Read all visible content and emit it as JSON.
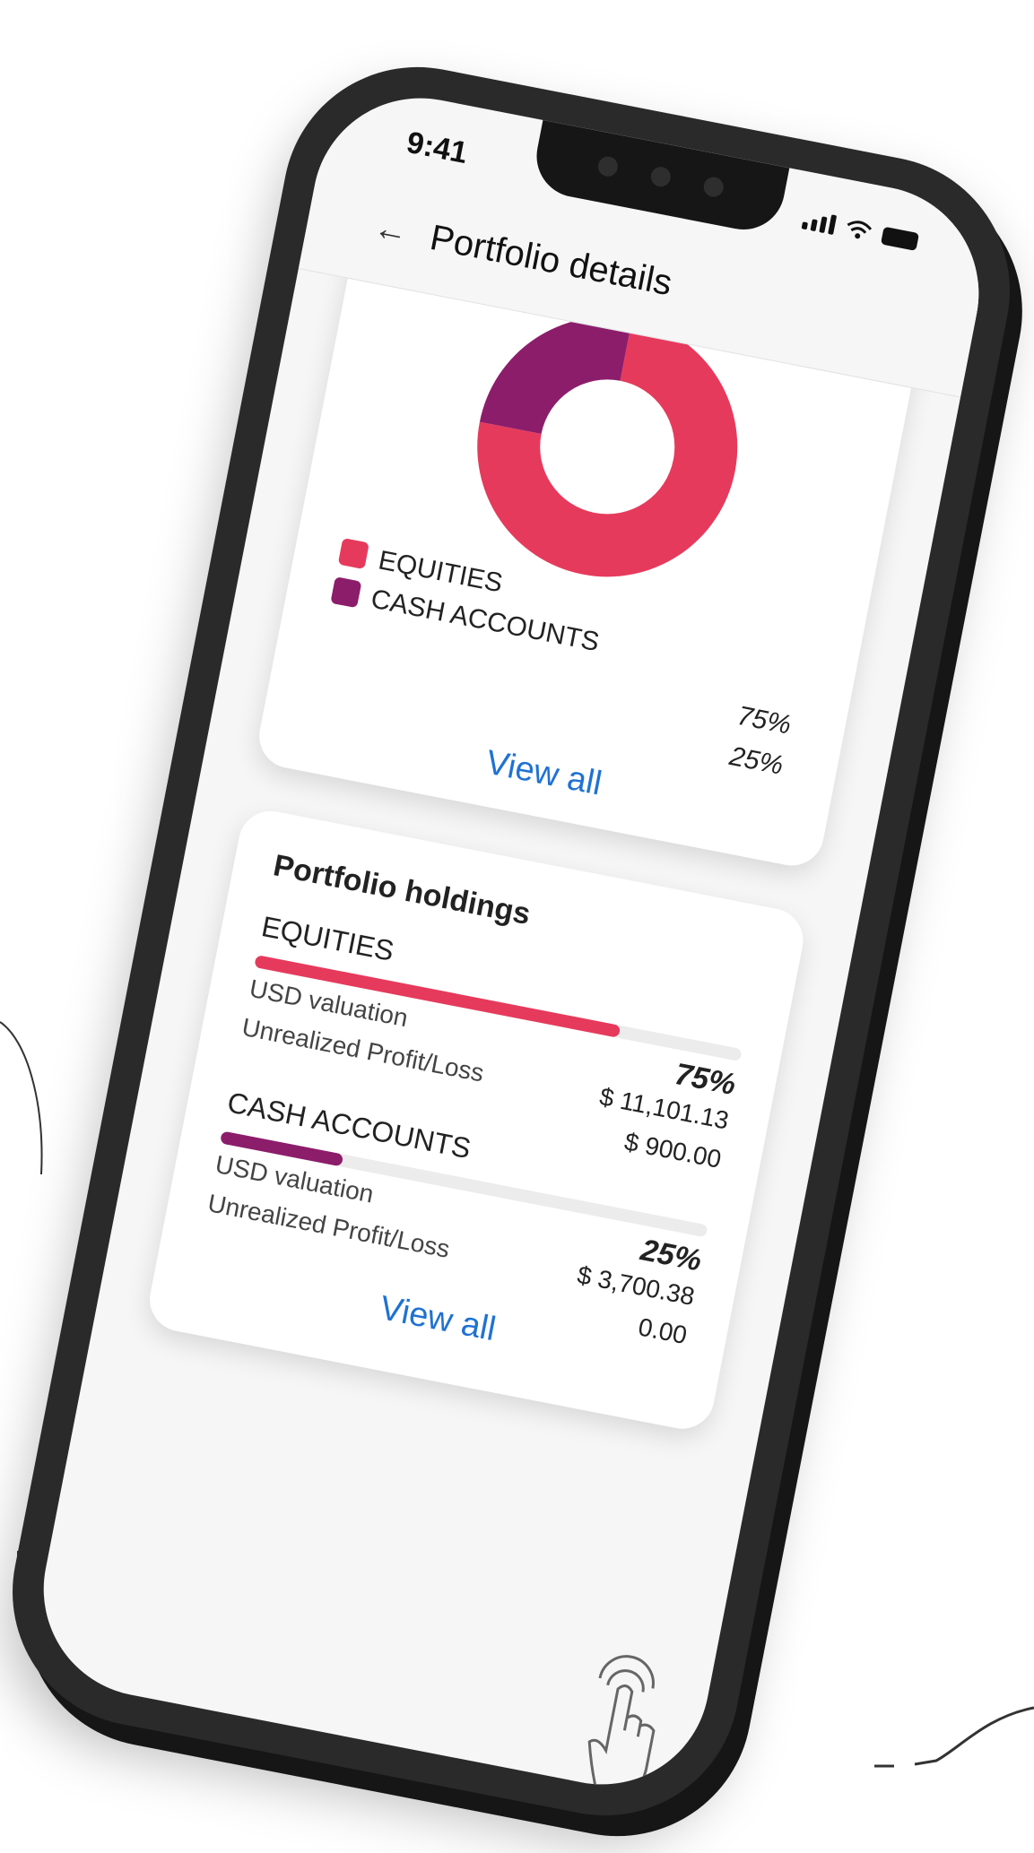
{
  "status_bar": {
    "time": "9:41"
  },
  "app_bar": {
    "back_icon": "arrow-left-icon",
    "title": "Portfolio details"
  },
  "allocation": {
    "legend": [
      {
        "label": "EQUITIES",
        "value": "75%",
        "color": "#e63a5c"
      },
      {
        "label": "CASH ACCOUNTS",
        "value": "25%",
        "color": "#8c1d6b"
      }
    ],
    "view_all": "View all"
  },
  "chart_data": {
    "type": "pie",
    "categories": [
      "EQUITIES",
      "CASH ACCOUNTS"
    ],
    "values": [
      75,
      25
    ],
    "colors": [
      "#e63a5c",
      "#8c1d6b"
    ],
    "donut": true
  },
  "holdings": {
    "title": "Portfolio holdings",
    "items": [
      {
        "category": "EQUITIES",
        "percent": "75%",
        "fraction": 0.75,
        "color": "#e63a5c",
        "usd_label": "USD valuation",
        "usd_value": "$ 11,101.13",
        "pl_label": "Unrealized Profit/Loss",
        "pl_value": "$ 900.00"
      },
      {
        "category": "CASH ACCOUNTS",
        "percent": "25%",
        "fraction": 0.25,
        "color": "#8c1d6b",
        "usd_label": "USD valuation",
        "usd_value": "$ 3,700.38",
        "pl_label": "Unrealized Profit/Loss",
        "pl_value": "0.00"
      }
    ],
    "view_all": "View all"
  },
  "gesture_icon": "tap-hand-icon"
}
